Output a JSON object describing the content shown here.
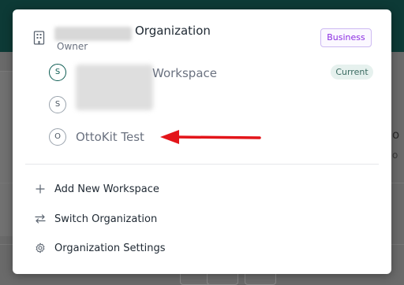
{
  "organization": {
    "name": "Organization",
    "role": "Owner",
    "plan_badge": "Business",
    "icon": "building-icon"
  },
  "workspaces": [
    {
      "avatar_letter": "S",
      "name": "Workspace",
      "badge": "Current",
      "active": true
    },
    {
      "avatar_letter": "S",
      "name": "",
      "active": false
    },
    {
      "avatar_letter": "O",
      "name": "OttoKit Test",
      "active": false
    }
  ],
  "menu": [
    {
      "label": "Add New Workspace",
      "icon": "plus-icon"
    },
    {
      "label": "Switch Organization",
      "icon": "switch-arrows-icon"
    },
    {
      "label": "Organization Settings",
      "icon": "gear-icon"
    }
  ],
  "annotation": {
    "type": "arrow",
    "color": "#e3151a",
    "points_to": "OttoKit Test"
  },
  "background": {
    "right_text": "o",
    "right_subtext": "o",
    "header_color": "#0d3a36"
  }
}
